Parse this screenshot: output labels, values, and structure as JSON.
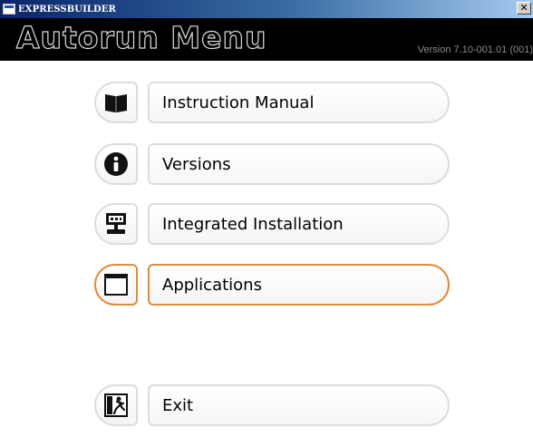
{
  "window": {
    "title": "EXPRESSBUILDER",
    "close_glyph": "✕"
  },
  "header": {
    "title": "Autorun Menu",
    "version": "Version 7.10-001.01 (001)"
  },
  "menu": {
    "items": [
      {
        "label": "Instruction Manual",
        "icon": "book-icon",
        "selected": false
      },
      {
        "label": "Versions",
        "icon": "info-icon",
        "selected": false
      },
      {
        "label": "Integrated Installation",
        "icon": "server-install-icon",
        "selected": false
      },
      {
        "label": "Applications",
        "icon": "window-icon",
        "selected": true
      },
      {
        "label": "Exit",
        "icon": "exit-door-icon",
        "selected": false
      }
    ]
  },
  "colors": {
    "selected_border": "#e38a3a",
    "pill_border": "#dcdcdc",
    "header_bg": "#000000"
  }
}
